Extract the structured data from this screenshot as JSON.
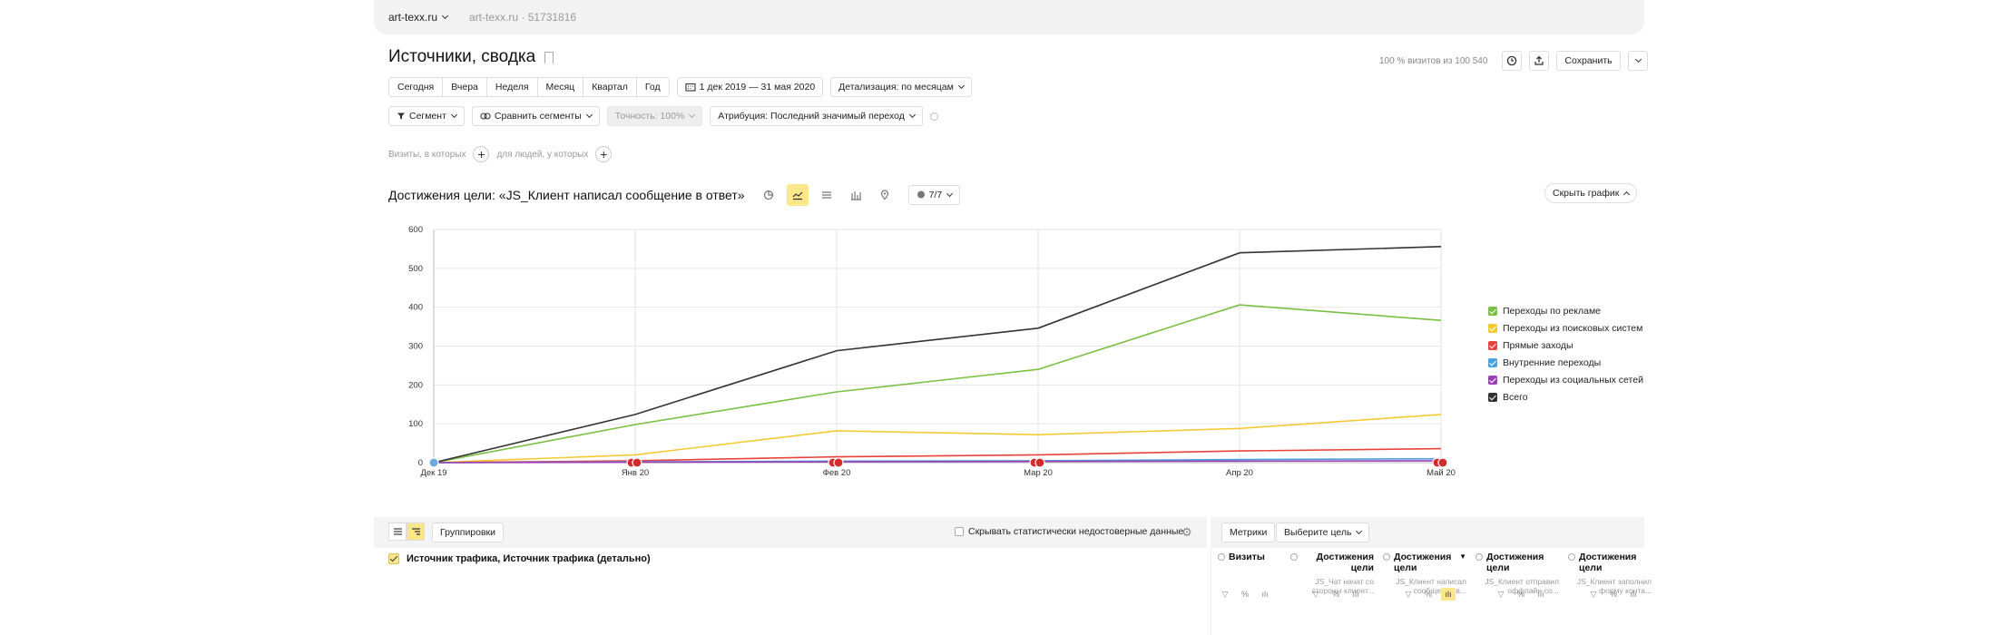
{
  "header": {
    "counter_name": "art-texx.ru",
    "counter_id": "art-texx.ru · 51731816"
  },
  "report": {
    "title": "Источники, сводка",
    "visits_share": "100 % визитов из 100 540",
    "save_label": "Сохранить"
  },
  "periods": [
    "Сегодня",
    "Вчера",
    "Неделя",
    "Месяц",
    "Квартал",
    "Год"
  ],
  "date_range": "1 дек 2019 — 31 мая 2020",
  "detail": "Детализация: по месяцам",
  "filters": {
    "segment": "Сегмент",
    "compare": "Сравнить сегменты",
    "accuracy": "Точность: 100%",
    "attribution": "Атрибуция: Последний значимый переход"
  },
  "conditions": {
    "visits": "Визиты, в которых",
    "people": "для людей, у которых"
  },
  "chart_header": {
    "title": "Достижения цели: «JS_Клиент написал сообщение в ответ»",
    "series_count": "7/7",
    "hide_chart": "Скрыть график"
  },
  "chart_data": {
    "type": "line",
    "categories": [
      "Дек 19",
      "Янв 20",
      "Фев 20",
      "Мар 20",
      "Апр 20",
      "Май 20"
    ],
    "yticks": [
      "0",
      "100",
      "200",
      "300",
      "400",
      "500",
      "600"
    ],
    "ylim": [
      0,
      600
    ],
    "grid": true,
    "legend_position": "right",
    "series": [
      {
        "name": "Переходы по рекламе",
        "color": "#7bbf44",
        "values": [
          0,
          98,
          182,
          240,
          406,
          366
        ]
      },
      {
        "name": "Переходы из поисковых систем",
        "color": "#f5c933",
        "values": [
          0,
          20,
          82,
          72,
          88,
          124
        ]
      },
      {
        "name": "Прямые заходы",
        "color": "#e8423a",
        "values": [
          0,
          5,
          15,
          20,
          30,
          36
        ]
      },
      {
        "name": "Внутренние переходы",
        "color": "#4aa3df",
        "values": [
          0,
          2,
          4,
          5,
          8,
          10
        ]
      },
      {
        "name": "Переходы из социальных сетей",
        "color": "#9b3fb5",
        "values": [
          0,
          1,
          2,
          3,
          4,
          5
        ]
      },
      {
        "name": "Всего",
        "color": "#333333",
        "values": [
          0,
          124,
          288,
          346,
          540,
          556
        ]
      }
    ]
  },
  "table": {
    "groupings_label": "Группировки",
    "hide_unreliable": "Скрывать статистически недостоверные данные",
    "metrics_label": "Метрики",
    "choose_goal": "Выберите цель",
    "dimension": "Источник трафика, Источник трафика (детально)",
    "columns": [
      {
        "title": "Визиты",
        "sub": ""
      },
      {
        "title": "Достижения цели",
        "sub": "JS_Чат начат со стороны клиент..."
      },
      {
        "title": "Достижения цели",
        "sub": "JS_Клиент написал сообщение в..."
      },
      {
        "title": "Достижения цели",
        "sub": "JS_Клиент отправил оффлайн-со..."
      },
      {
        "title": "Достижения цели",
        "sub": "JS_Клиент заполнил форму конта..."
      }
    ]
  }
}
